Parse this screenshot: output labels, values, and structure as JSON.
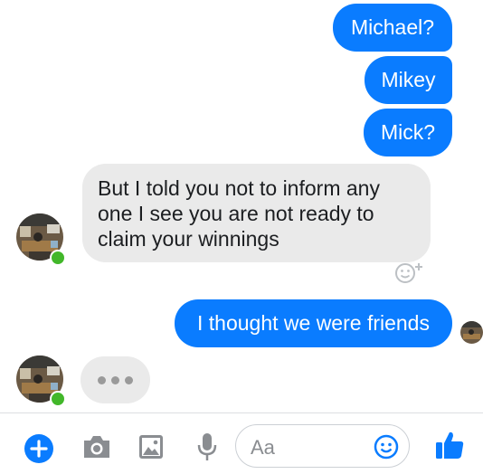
{
  "thread": {
    "messages": [
      {
        "sender": "me",
        "text": "Michael?"
      },
      {
        "sender": "me",
        "text": "Mikey"
      },
      {
        "sender": "me",
        "text": "Mick?"
      },
      {
        "sender": "them",
        "text": "But I told you not to inform any one I see you are not ready to claim your winnings"
      },
      {
        "sender": "me",
        "text": "I thought we were friends"
      }
    ],
    "contact_status": "online",
    "typing": true
  },
  "composer": {
    "placeholder": "Aa",
    "icons": [
      "plus-icon",
      "camera-icon",
      "image-icon",
      "microphone-icon",
      "emoji-icon",
      "thumbs-up-icon"
    ]
  },
  "colors": {
    "outgoing_bubble": "#0a7cff",
    "incoming_bubble": "#eaeaea",
    "accent": "#0a7cff",
    "online": "#42b72a"
  }
}
